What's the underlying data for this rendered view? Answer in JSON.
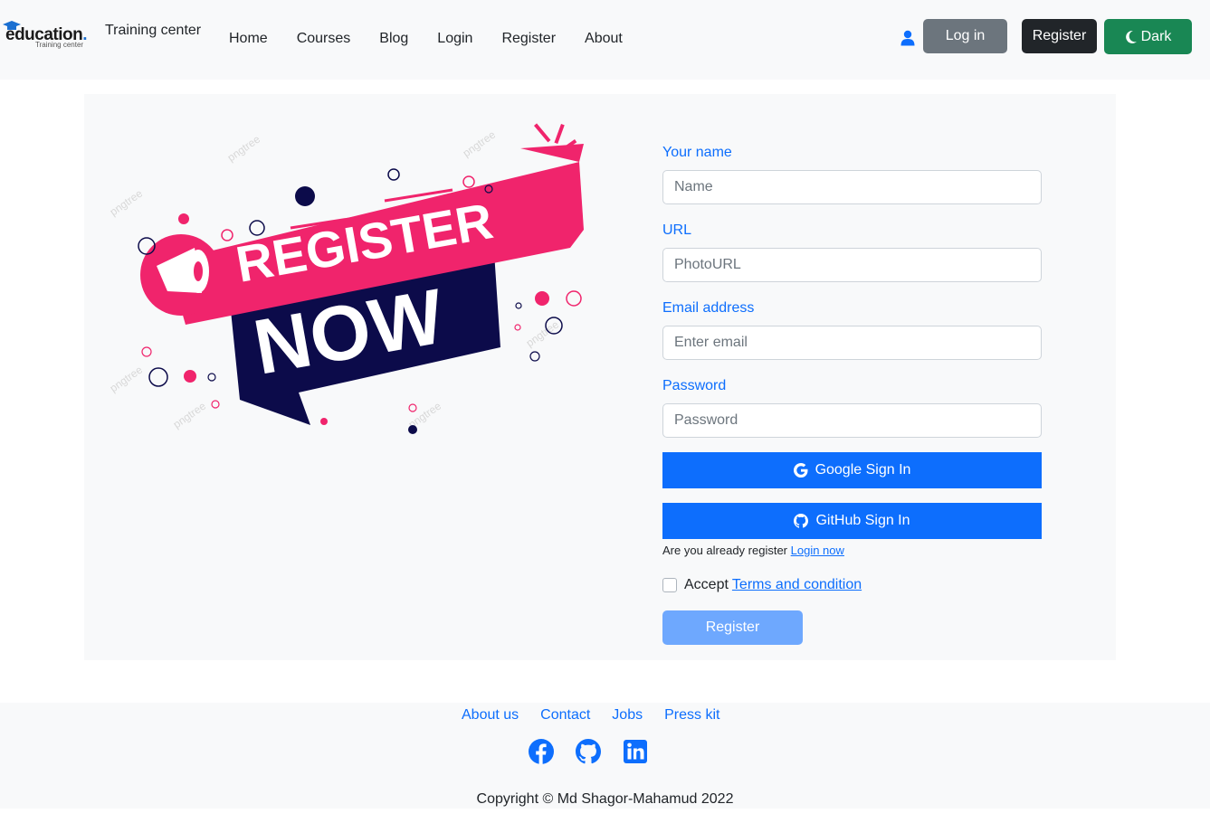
{
  "navbar": {
    "logo_main": "education",
    "logo_sub": "Training center",
    "brand_text": "Training center",
    "links": [
      "Home",
      "Courses",
      "Blog",
      "Login",
      "Register",
      "About"
    ],
    "login_label": "Log in",
    "register_label": "Register",
    "dark_label": "Dark"
  },
  "promo": {
    "line1": "REGISTER",
    "line2": "NOW",
    "watermark": "pngtree"
  },
  "form": {
    "name_label": "Your name",
    "name_placeholder": "Name",
    "url_label": "URL",
    "url_placeholder": "PhotoURL",
    "email_label": "Email address",
    "email_placeholder": "Enter email",
    "password_label": "Password",
    "password_placeholder": "Password",
    "google_label": "Google Sign In",
    "github_label": "GitHub Sign In",
    "already_text": "Are you already register",
    "login_now": "Login now",
    "accept_text": "Accept",
    "terms_link": "Terms and condition",
    "submit_label": "Register"
  },
  "footer": {
    "links": [
      "About us",
      "Contact",
      "Jobs",
      "Press kit"
    ],
    "social_icons": [
      "facebook-icon",
      "github-icon",
      "linkedin-icon"
    ],
    "copyright": "Copyright © Md Shagor-Mahamud 2022"
  },
  "colors": {
    "primary": "#0d6efd",
    "success": "#198754",
    "pink": "#f0246c",
    "navy": "#0c0b4a"
  }
}
